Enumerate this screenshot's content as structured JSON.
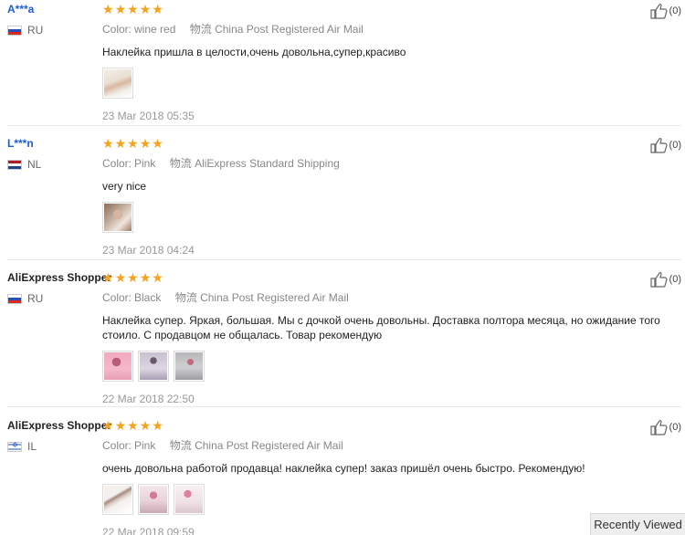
{
  "reviews": [
    {
      "user": "A***a",
      "country": "RU",
      "stars": 5,
      "color_label": "Color:",
      "color_value": "wine red",
      "shipping_label": "物流",
      "shipping_value": "China Post Registered Air Mail",
      "text": "Наклейка пришла в целости,очень довольна,супер,красиво",
      "date": "23 Mar 2018 05:35",
      "likes": "(0)"
    },
    {
      "user": "L***n",
      "country": "NL",
      "stars": 5,
      "color_label": "Color:",
      "color_value": "Pink",
      "shipping_label": "物流",
      "shipping_value": "AliExpress Standard Shipping",
      "text": "very nice",
      "date": "23 Mar 2018 04:24",
      "likes": "(0)"
    },
    {
      "user": "AliExpress Shopper",
      "country": "RU",
      "stars": 5,
      "color_label": "Color:",
      "color_value": "Black",
      "shipping_label": "物流",
      "shipping_value": "China Post Registered Air Mail",
      "text": "Наклейка супер. Яркая, большая. Мы с дочкой очень довольны. Доставка полтора месяца, но ожидание того стоило. С продавцом не общалась. Товар рекомендую",
      "date": "22 Mar 2018 22:50",
      "likes": "(0)"
    },
    {
      "user": "AliExpress Shopper",
      "country": "IL",
      "stars": 5,
      "color_label": "Color:",
      "color_value": "Pink",
      "shipping_label": "物流",
      "shipping_value": "China Post Registered Air Mail",
      "text": "очень довольна работой продавца! наклейка супер! заказ пришёл очень быстро. Рекомендую!",
      "date": "22 Mar 2018 09:59",
      "likes": "(0)"
    }
  ],
  "recently_viewed": "Recently Viewed",
  "colors": {
    "star": "#f7a21b",
    "link_user": "#1a5ed6"
  }
}
